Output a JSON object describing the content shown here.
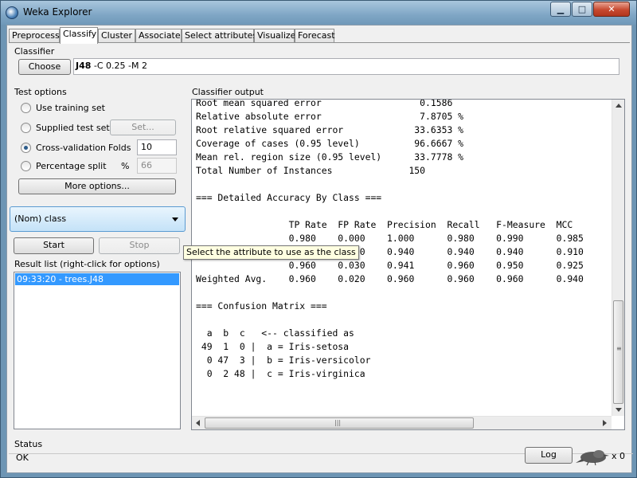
{
  "window": {
    "title": "Weka Explorer",
    "controls": {
      "minimize": "▁",
      "maximize": "□",
      "close": "✕"
    }
  },
  "tabs": [
    {
      "label": "Preprocess",
      "active": false
    },
    {
      "label": "Classify",
      "active": true
    },
    {
      "label": "Cluster",
      "active": false
    },
    {
      "label": "Associate",
      "active": false
    },
    {
      "label": "Select attributes",
      "active": false
    },
    {
      "label": "Visualize",
      "active": false
    },
    {
      "label": "Forecast",
      "active": false
    }
  ],
  "classifier": {
    "group_label": "Classifier",
    "choose_label": "Choose",
    "name": "J48",
    "options": " -C 0.25 -M 2"
  },
  "test_options": {
    "group_label": "Test options",
    "use_training_set": "Use training set",
    "supplied_test_set": "Supplied test set",
    "set_button": "Set...",
    "cross_validation": "Cross-validation",
    "folds_label": "Folds",
    "folds_value": "10",
    "percentage_split": "Percentage split",
    "percent_symbol": "%",
    "percent_value": "66",
    "more_options": "More options...",
    "selected": "cross_validation"
  },
  "class_selector": {
    "value": "(Nom) class",
    "tooltip": "Select the attribute to use as the class"
  },
  "actions": {
    "start": "Start",
    "stop": "Stop"
  },
  "result_list": {
    "label": "Result list (right-click for options)",
    "items": [
      "09:33:20 - trees.J48"
    ]
  },
  "output": {
    "label": "Classifier output",
    "lines": [
      "Root mean squared error                  0.1586",
      "Relative absolute error                  7.8705 %",
      "Root relative squared error             33.6353 %",
      "Coverage of cases (0.95 level)          96.6667 %",
      "Mean rel. region size (0.95 level)      33.7778 %",
      "Total Number of Instances              150",
      "",
      "=== Detailed Accuracy By Class ===",
      "",
      "                 TP Rate  FP Rate  Precision  Recall   F-Measure  MCC",
      "                 0.980    0.000    1.000      0.980    0.990      0.985",
      "                 0.940    0.030    0.940      0.940    0.940      0.910",
      "                 0.960    0.030    0.941      0.960    0.950      0.925",
      "Weighted Avg.    0.960    0.020    0.960      0.960    0.960      0.940",
      "",
      "=== Confusion Matrix ===",
      "",
      "  a  b  c   <-- classified as",
      " 49  1  0 |  a = Iris-setosa",
      "  0 47  3 |  b = Iris-versicolor",
      "  0  2 48 |  c = Iris-virginica"
    ]
  },
  "status": {
    "label": "Status",
    "text": "OK",
    "log_button": "Log",
    "task_count": "x 0"
  },
  "colors": {
    "selection": "#3399ff",
    "title_gradient_top": "#a9c6dd",
    "client_bg": "#f0f0f0"
  }
}
